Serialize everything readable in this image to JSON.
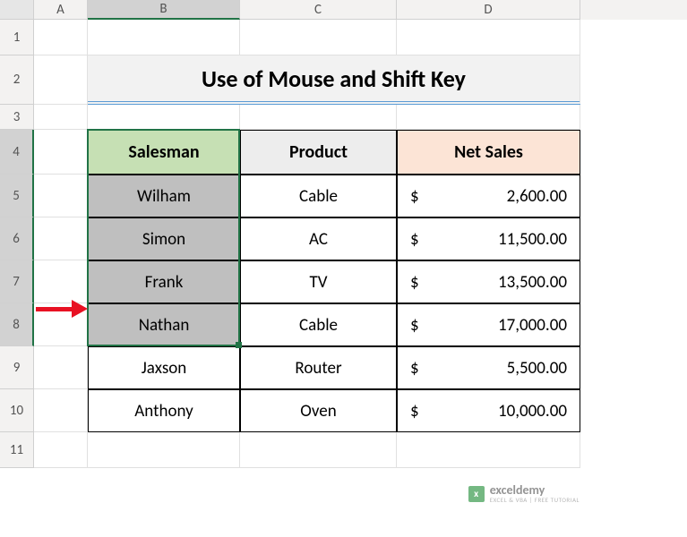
{
  "columns": [
    "A",
    "B",
    "C",
    "D"
  ],
  "rows": [
    "1",
    "2",
    "3",
    "4",
    "5",
    "6",
    "7",
    "8",
    "9",
    "10",
    "11"
  ],
  "title": "Use of Mouse and Shift Key",
  "headers": {
    "b": "Salesman",
    "c": "Product",
    "d": "Net Sales"
  },
  "data": [
    {
      "salesman": "Wilham",
      "product": "Cable",
      "sales": "2,600.00"
    },
    {
      "salesman": "Simon",
      "product": "AC",
      "sales": "11,500.00"
    },
    {
      "salesman": "Frank",
      "product": "TV",
      "sales": "13,500.00"
    },
    {
      "salesman": "Nathan",
      "product": "Cable",
      "sales": "17,000.00"
    },
    {
      "salesman": "Jaxson",
      "product": "Router",
      "sales": "5,500.00"
    },
    {
      "salesman": "Anthony",
      "product": "Oven",
      "sales": "10,000.00"
    }
  ],
  "currency": "$",
  "watermark": {
    "title": "exceldemy",
    "sub": "EXCEL & VBA | FREE TUTORIAL"
  },
  "chart_data": {
    "type": "table",
    "title": "Use of Mouse and Shift Key",
    "columns": [
      "Salesman",
      "Product",
      "Net Sales"
    ],
    "rows": [
      [
        "Wilham",
        "Cable",
        2600.0
      ],
      [
        "Simon",
        "AC",
        11500.0
      ],
      [
        "Frank",
        "TV",
        13500.0
      ],
      [
        "Nathan",
        "Cable",
        17000.0
      ],
      [
        "Jaxson",
        "Router",
        5500.0
      ],
      [
        "Anthony",
        "Oven",
        10000.0
      ]
    ],
    "currency": "USD",
    "selection": {
      "range": "B4:B8",
      "description": "Header + first 4 salesman cells selected"
    }
  }
}
